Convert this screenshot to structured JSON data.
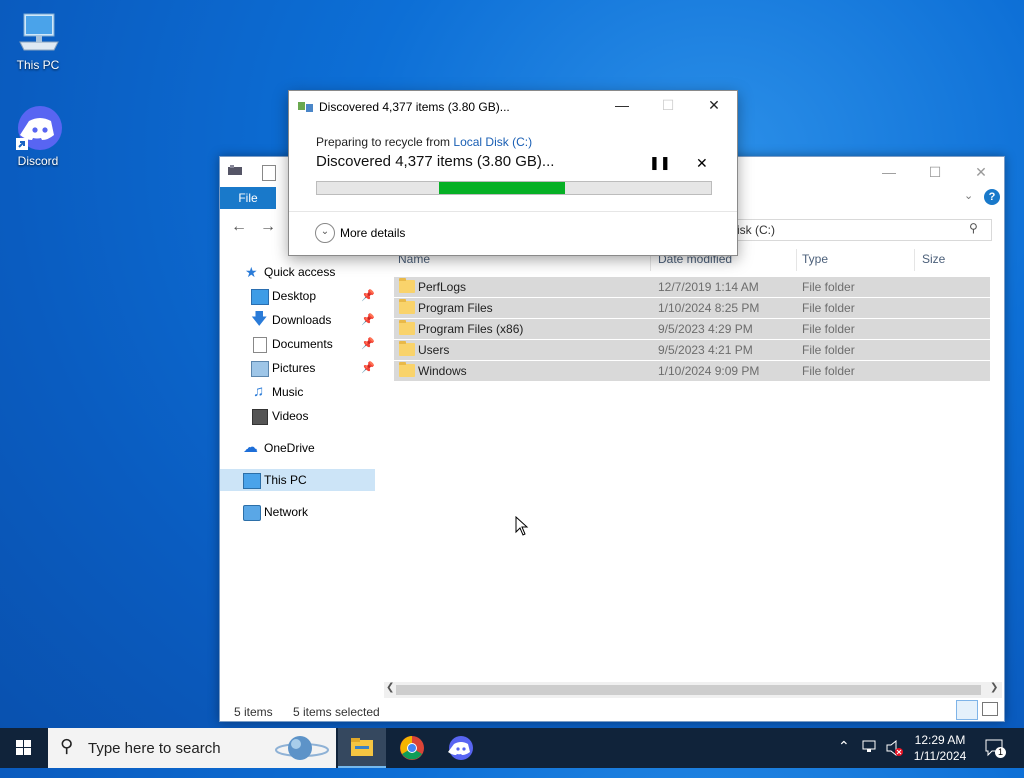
{
  "desktop": {
    "icons": [
      {
        "label": "This PC"
      },
      {
        "label": "Discord"
      }
    ]
  },
  "explorer": {
    "file_tab": "File",
    "address": "Local Disk (C:)",
    "address_visible": "isk (C:)",
    "nav": {
      "quick_access": "Quick access",
      "items": [
        {
          "label": "Desktop",
          "pinned": true
        },
        {
          "label": "Downloads",
          "pinned": true
        },
        {
          "label": "Documents",
          "pinned": true
        },
        {
          "label": "Pictures",
          "pinned": true
        },
        {
          "label": "Music",
          "pinned": false
        },
        {
          "label": "Videos",
          "pinned": false
        }
      ],
      "onedrive": "OneDrive",
      "this_pc": "This PC",
      "network": "Network"
    },
    "columns": {
      "name": "Name",
      "date": "Date modified",
      "type": "Type",
      "size": "Size"
    },
    "rows": [
      {
        "name": "PerfLogs",
        "date": "12/7/2019 1:14 AM",
        "type": "File folder"
      },
      {
        "name": "Program Files",
        "date": "1/10/2024 8:25 PM",
        "type": "File folder"
      },
      {
        "name": "Program Files (x86)",
        "date": "9/5/2023 4:29 PM",
        "type": "File folder"
      },
      {
        "name": "Users",
        "date": "9/5/2023 4:21 PM",
        "type": "File folder"
      },
      {
        "name": "Windows",
        "date": "1/10/2024 9:09 PM",
        "type": "File folder"
      }
    ],
    "status": {
      "count": "5 items",
      "selected": "5 items selected"
    }
  },
  "dialog": {
    "title": "Discovered 4,377 items (3.80 GB)...",
    "sub_prefix": "Preparing to recycle from ",
    "sub_link": "Local Disk (C:)",
    "headline": "Discovered 4,377 items (3.80 GB)...",
    "progress": 0.32,
    "more_details": "More details"
  },
  "taskbar": {
    "search_placeholder": "Type here to search",
    "time": "12:29 AM",
    "date": "1/11/2024",
    "notification_count": "1"
  },
  "colors": {
    "accent": "#1979ca",
    "progress": "#06b025",
    "selection": "#d9d9d9"
  }
}
